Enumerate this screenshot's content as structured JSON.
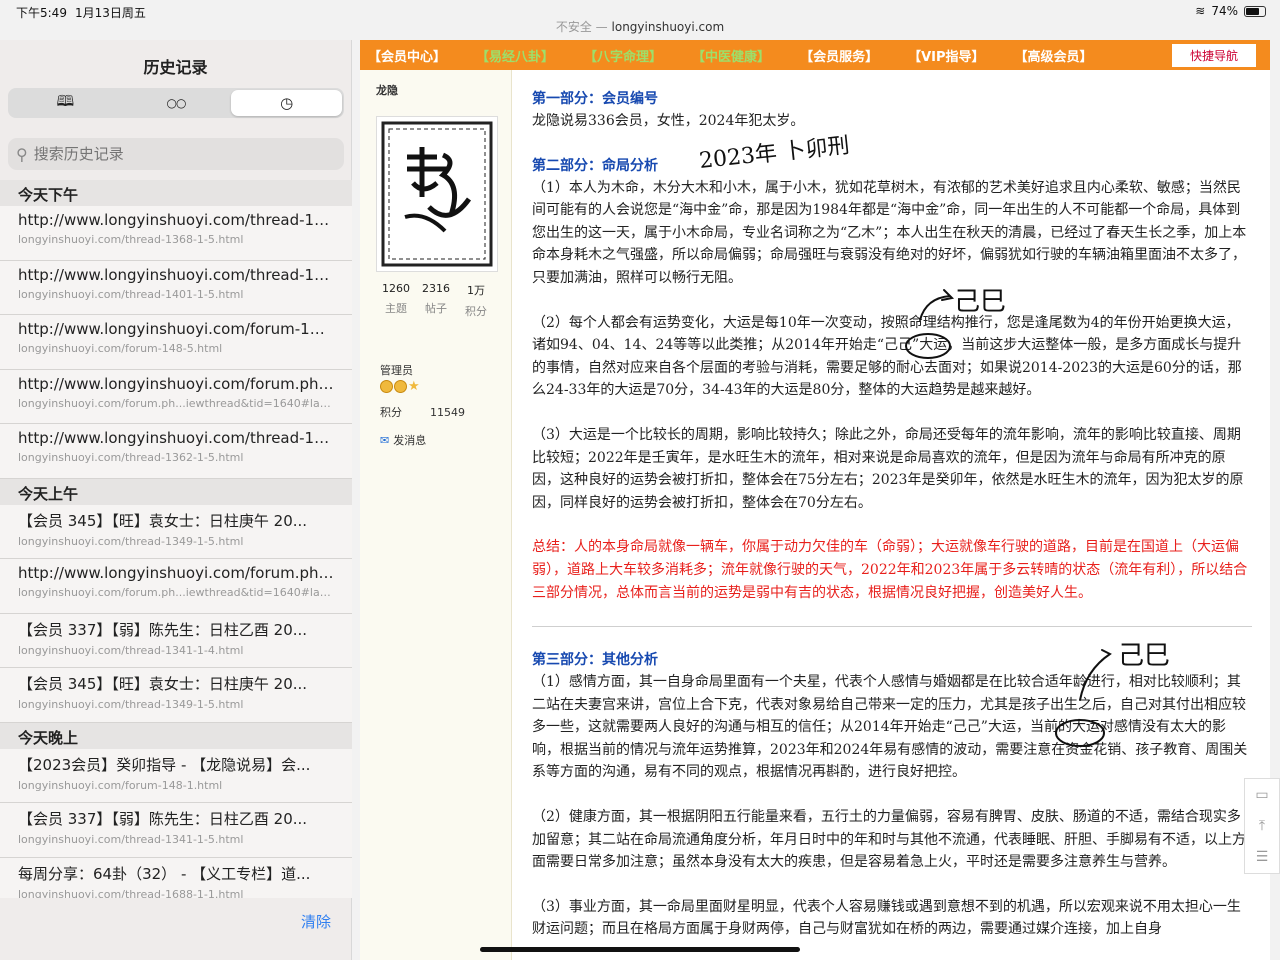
{
  "status": {
    "time": "下午5:49",
    "date": "1月13日周五",
    "battery": "74%",
    "battery_level": 0.74
  },
  "url": {
    "warning": "不安全 —",
    "host": "longyinshuoyi.com"
  },
  "sidebar": {
    "title": "历史记录",
    "tabs": [
      {
        "icon": "book-icon",
        "glyph": "🕮"
      },
      {
        "icon": "reading-list-icon",
        "glyph": "○○"
      },
      {
        "icon": "clock-icon",
        "glyph": "◷"
      }
    ],
    "search_placeholder": "搜索历史记录",
    "clear_label": "清除",
    "sections": [
      {
        "label": "今天下午",
        "items": [
          {
            "title": "http://www.longyinshuoyi.com/thread-136...",
            "url": "longyinshuoyi.com/thread-1368-1-5.html"
          },
          {
            "title": "http://www.longyinshuoyi.com/thread-1401...",
            "url": "longyinshuoyi.com/thread-1401-1-5.html"
          },
          {
            "title": "http://www.longyinshuoyi.com/forum-148-...",
            "url": "longyinshuoyi.com/forum-148-5.html"
          },
          {
            "title": "http://www.longyinshuoyi.com/forum.php?...",
            "url": "longyinshuoyi.com/forum.ph...iewthread&tid=1640#lastpost"
          },
          {
            "title": "http://www.longyinshuoyi.com/thread-136...",
            "url": "longyinshuoyi.com/thread-1362-1-5.html"
          }
        ]
      },
      {
        "label": "今天上午",
        "items": [
          {
            "title": "【会员 345】【旺】袁女士：日柱庚午 20...",
            "url": "longyinshuoyi.com/thread-1349-1-5.html"
          },
          {
            "title": "http://www.longyinshuoyi.com/forum.php?...",
            "url": "longyinshuoyi.com/forum.ph...iewthread&tid=1640#lastpost"
          },
          {
            "title": "【会员 337】【弱】陈先生：日柱乙酉 20...",
            "url": "longyinshuoyi.com/thread-1341-1-4.html"
          },
          {
            "title": "【会员 345】【旺】袁女士：日柱庚午 20...",
            "url": "longyinshuoyi.com/thread-1349-1-5.html"
          }
        ]
      },
      {
        "label": "今天晚上",
        "items": [
          {
            "title": "【2023会员】癸卯指导 - 【龙隐说易】会...",
            "url": "longyinshuoyi.com/forum-148-1.html"
          },
          {
            "title": "【会员 337】【弱】陈先生：日柱乙酉 20...",
            "url": "longyinshuoyi.com/thread-1341-1-5.html"
          },
          {
            "title": "每周分享：64卦（32） - 【义工专栏】道...",
            "url": "longyinshuoyi.com/thread-1688-1-1.html"
          }
        ]
      }
    ]
  },
  "nav": {
    "items": [
      {
        "label": "【会员中心】",
        "style": "w"
      },
      {
        "label": "【易经八卦】",
        "style": "g"
      },
      {
        "label": "【八字命理】",
        "style": "g"
      },
      {
        "label": "【中医健康】",
        "style": "g"
      },
      {
        "label": "【会员服务】",
        "style": "w"
      },
      {
        "label": "【VIP指导】",
        "style": "w"
      },
      {
        "label": "【高级会员】",
        "style": "w"
      }
    ],
    "quick_label": "快捷导航"
  },
  "author": {
    "name": "龙隐",
    "stats": [
      {
        "value": "1260",
        "label": "主题"
      },
      {
        "value": "2316",
        "label": "帖子"
      },
      {
        "value": "1万",
        "label": "积分"
      }
    ],
    "role": "管理员",
    "points_label": "积分",
    "points_value": "11549",
    "message_label": "发消息"
  },
  "post": {
    "h1": "第一部分：会员编号",
    "p1": "龙隐说易336会员，女性，2024年犯太岁。",
    "h2": "第二部分：命局分析",
    "p2": "（1）本人为木命，木分大木和小木，属于小木，犹如花草树木，有浓郁的艺术美好追求且内心柔软、敏感；当然民间可能有的人会说您是“海中金”命，那是因为1984年都是“海中金”命，同一年出生的人不可能都一个命局，具体到您出生的这一天，属于小木命局，专业名词称之为“乙木”；本人出生在秋天的清晨，已经过了春天生长之季，加上本命本身耗木之气强盛，所以命局偏弱；命局强旺与衰弱没有绝对的好坏，偏弱犹如行驶的车辆油箱里面油不太多了，只要加满油，照样可以畅行无阻。",
    "p3": "（2）每个人都会有运势变化，大运是每10年一次变动，按照命理结构推行，您是逢尾数为4的年份开始更换大运，诸如94、04、14、24等等以此类推；从2014年开始走“己己”大运，当前这步大运整体一般，是多方面成长与提升的事情，自然对应来自各个层面的考验与消耗，需要足够的耐心去面对；如果说2014-2023的大运是60分的话，那么24-33年的大运是70分，34-43年的大运是80分，整体的大运趋势是越来越好。",
    "p4": "（3）大运是一个比较长的周期，影响比较持久；除此之外，命局还受每年的流年影响，流年的影响比较直接、周期比较短；2022年是壬寅年，是水旺生木的流年，相对来说是命局喜欢的流年，但是因为流年与命局有所冲克的原因，这种良好的运势会被打折扣，整体会在75分左右；2023年是癸卯年，依然是水旺生木的流年，因为犯太岁的原因，同样良好的运势会被打折扣，整体会在70分左右。",
    "summary": "总结：人的本身命局就像一辆车，你属于动力欠佳的车（命弱）；大运就像车行驶的道路，目前是在国道上（大运偏弱），道路上大车较多消耗多；流年就像行驶的天气，2022年和2023年属于多云转晴的状态（流年有利），所以结合三部分情况，总体而言当前的运势是弱中有吉的状态，根据情况良好把握，创造美好人生。",
    "h3": "第三部分：其他分析",
    "p5": "（1）感情方面，其一自身命局里面有一个夫星，代表个人感情与婚姻都是在比较合适年龄进行，相对比较顺利；其二站在夫妻宫来讲，宫位上合下克，代表对象易给自己带来一定的压力，尤其是孩子出生之后，自己对其付出相应较多一些，这就需要两人良好的沟通与相互的信任；从2014年开始走“己己”大运，当前的大运对感情没有太大的影响，根据当前的情况与流年运势推算，2023年和2024年易有感情的波动，需要注意在资金花销、孩子教育、周围关系等方面的沟通，易有不同的观点，根据情况再斟酌，进行良好把控。",
    "p6": "（2）健康方面，其一根据阴阳五行能量来看，五行土的力量偏弱，容易有脾胃、皮肤、肠道的不适，需结合现实多加留意；其二站在命局流通角度分析，年月日时中的年和时与其他不流通，代表睡眠、肝胆、手脚易有不适，以上方面需要日常多加注意；虽然本身没有太大的疾患，但是容易着急上火，平时还是需要多注意养生与营养。",
    "p7": "（3）事业方面，其一命局里面财星明显，代表个人容易赚钱或遇到意想不到的机遇，所以宏观来说不用太担心一生财运问题；而且在格局方面属于身财两停，自己与财富犹如在桥的两边，需要通过媒介连接，加上自身"
  },
  "handwriting": [
    "2023年 卜卯刑",
    "己巳",
    "己巳"
  ]
}
